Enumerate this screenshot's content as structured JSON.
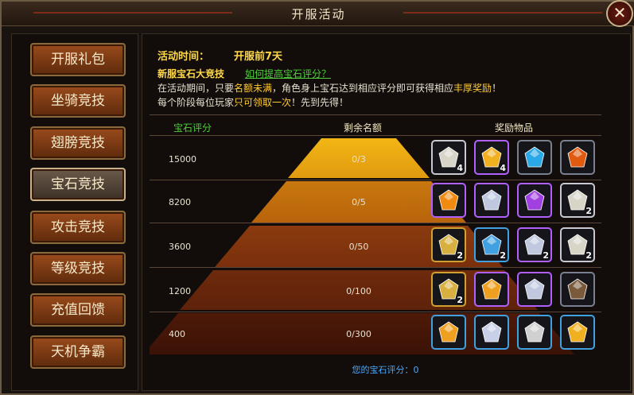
{
  "window": {
    "title": "开服活动",
    "close_label": "✕"
  },
  "menu": [
    {
      "label": "开服礼包",
      "active": false
    },
    {
      "label": "坐骑竞技",
      "active": false
    },
    {
      "label": "翅膀竞技",
      "active": false
    },
    {
      "label": "宝石竞技",
      "active": true
    },
    {
      "label": "攻击竞技",
      "active": false
    },
    {
      "label": "等级竞技",
      "active": false
    },
    {
      "label": "充值回馈",
      "active": false
    },
    {
      "label": "天机争霸",
      "active": false
    }
  ],
  "info": {
    "time_label": "活动时间：",
    "time_value": "开服前7天",
    "event_title": "新服宝石大竞技",
    "help_link": "如何提高宝石评分？",
    "line1_a": "在活动期间，只要",
    "line1_b": "名额未满",
    "line1_c": "，角色身上宝石达到相应评分即可获得相应",
    "line1_d": "丰厚奖励",
    "line1_e": "！",
    "line2_a": "每个阶段每位玩家",
    "line2_b": "只可领取一次",
    "line2_c": "！先到先得！"
  },
  "table": {
    "headers": [
      "宝石评分",
      "剩余名额",
      "奖励物品"
    ],
    "rows": [
      {
        "score": "15000",
        "remain": "0/3",
        "rewards": [
          {
            "icon": "silver-urn-icon",
            "count": "4",
            "color": "#d8d4c8",
            "border": "#c8c8d0"
          },
          {
            "icon": "gold-crystal-icon",
            "count": "4",
            "color": "#f0b020",
            "border": "#b060ff"
          },
          {
            "icon": "blue-diamond-icon",
            "count": "",
            "color": "#2aa8e8",
            "border": "#7a8090"
          },
          {
            "icon": "fire-golem-icon",
            "count": "",
            "color": "#e05a10",
            "border": "#7a8090"
          }
        ]
      },
      {
        "score": "8200",
        "remain": "0/5",
        "rewards": [
          {
            "icon": "orange-crystal-icon",
            "count": "",
            "color": "#f08a10",
            "border": "#b060ff"
          },
          {
            "icon": "silver-crystal-icon",
            "count": "",
            "color": "#c0c8e0",
            "border": "#b060ff"
          },
          {
            "icon": "purple-crystal-icon",
            "count": "",
            "color": "#a040e0",
            "border": "#b060ff"
          },
          {
            "icon": "silver-urn-icon",
            "count": "2",
            "color": "#d8d4c8",
            "border": "#c8c8d0"
          }
        ]
      },
      {
        "score": "3600",
        "remain": "0/50",
        "rewards": [
          {
            "icon": "gold-shovel-icon",
            "count": "2",
            "color": "#d8b040",
            "border": "#d0a030"
          },
          {
            "icon": "blue-shovel-icon",
            "count": "2",
            "color": "#40a0e0",
            "border": "#40a0e0"
          },
          {
            "icon": "silver-crystal-icon",
            "count": "2",
            "color": "#c0c8e0",
            "border": "#b060ff"
          },
          {
            "icon": "silver-urn-icon",
            "count": "2",
            "color": "#d8d4c8",
            "border": "#c8c8d0"
          }
        ]
      },
      {
        "score": "1200",
        "remain": "0/100",
        "rewards": [
          {
            "icon": "gold-shovel-icon",
            "count": "2",
            "color": "#d8b040",
            "border": "#d0a030"
          },
          {
            "icon": "orange-crystal-icon",
            "count": "",
            "color": "#f0a020",
            "border": "#b060ff"
          },
          {
            "icon": "silver-crystal-icon",
            "count": "",
            "color": "#c0c8e0",
            "border": "#b060ff"
          },
          {
            "icon": "bronze-teapot-icon",
            "count": "",
            "color": "#7a5a3a",
            "border": "#7a8090"
          }
        ]
      },
      {
        "score": "400",
        "remain": "0/300",
        "rewards": [
          {
            "icon": "orange-crystal-icon",
            "count": "",
            "color": "#f0a020",
            "border": "#40a0e0"
          },
          {
            "icon": "silver-crystal-icon",
            "count": "",
            "color": "#c8d0e8",
            "border": "#40a0e0"
          },
          {
            "icon": "silver-ingot-icon",
            "count": "",
            "color": "#d0d0d0",
            "border": "#40a0e0"
          },
          {
            "icon": "gold-ingot-icon",
            "count": "",
            "color": "#f0b020",
            "border": "#40a0e0"
          }
        ]
      }
    ],
    "footer": "您的宝石评分：0"
  }
}
